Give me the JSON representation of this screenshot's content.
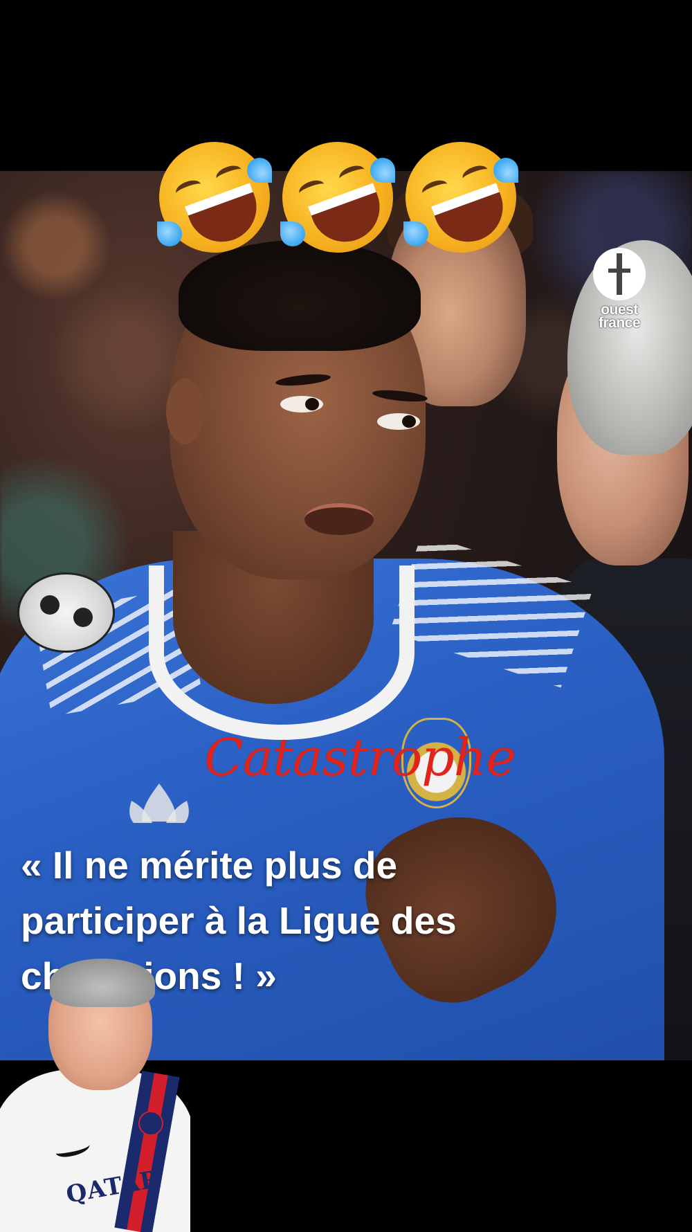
{
  "overlay": {
    "emojis": [
      "rolling-on-floor-laughing",
      "rolling-on-floor-laughing",
      "rolling-on-floor-laughing"
    ],
    "script_word": "Catastrophe",
    "script_color": "#e0241b"
  },
  "logo": {
    "line1": "ouest",
    "line2": "france"
  },
  "quote": {
    "line1": "« Il ne mérite plus de",
    "line2": "participer à la Ligue des",
    "line3": "champions ! »"
  },
  "webcam": {
    "sponsor_text": "QATAR"
  },
  "colors": {
    "jersey_blue": "#2a5fc3",
    "background": "#000000",
    "quote_text": "#ffffff"
  }
}
